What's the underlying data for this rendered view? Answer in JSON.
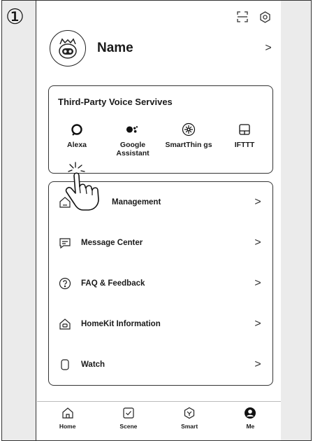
{
  "step_marker": "①",
  "header": {
    "scan_icon": "scan-icon",
    "settings_icon": "settings-icon"
  },
  "profile": {
    "name": "Name",
    "avatar_icon": "robot-avatar-icon",
    "chevron": ">"
  },
  "voice_services": {
    "title": "Third-Party Voice Servives",
    "items": [
      {
        "label": "Alexa",
        "icon": "alexa-icon"
      },
      {
        "label": "Google Assistant",
        "icon": "google-assistant-icon"
      },
      {
        "label": "SmartThin gs",
        "icon": "smartthings-icon"
      },
      {
        "label": "IFTTT",
        "icon": "ifttt-icon"
      }
    ]
  },
  "menu": {
    "items": [
      {
        "label": "Management",
        "icon": "home-icon",
        "chevron": ">"
      },
      {
        "label": "Message Center",
        "icon": "message-icon",
        "chevron": ">"
      },
      {
        "label": "FAQ & Feedback",
        "icon": "help-icon",
        "chevron": ">"
      },
      {
        "label": "HomeKit Information",
        "icon": "homekit-icon",
        "chevron": ">"
      },
      {
        "label": "Watch",
        "icon": "watch-icon",
        "chevron": ">"
      }
    ]
  },
  "tabbar": {
    "tabs": [
      {
        "label": "Home",
        "icon": "home-tab-icon"
      },
      {
        "label": "Scene",
        "icon": "scene-tab-icon"
      },
      {
        "label": "Smart",
        "icon": "smart-tab-icon"
      },
      {
        "label": "Me",
        "icon": "me-tab-icon",
        "active": true
      }
    ]
  },
  "colors": {
    "ink": "#1a1a1a",
    "border": "#333333",
    "gutter": "#ebebeb"
  }
}
